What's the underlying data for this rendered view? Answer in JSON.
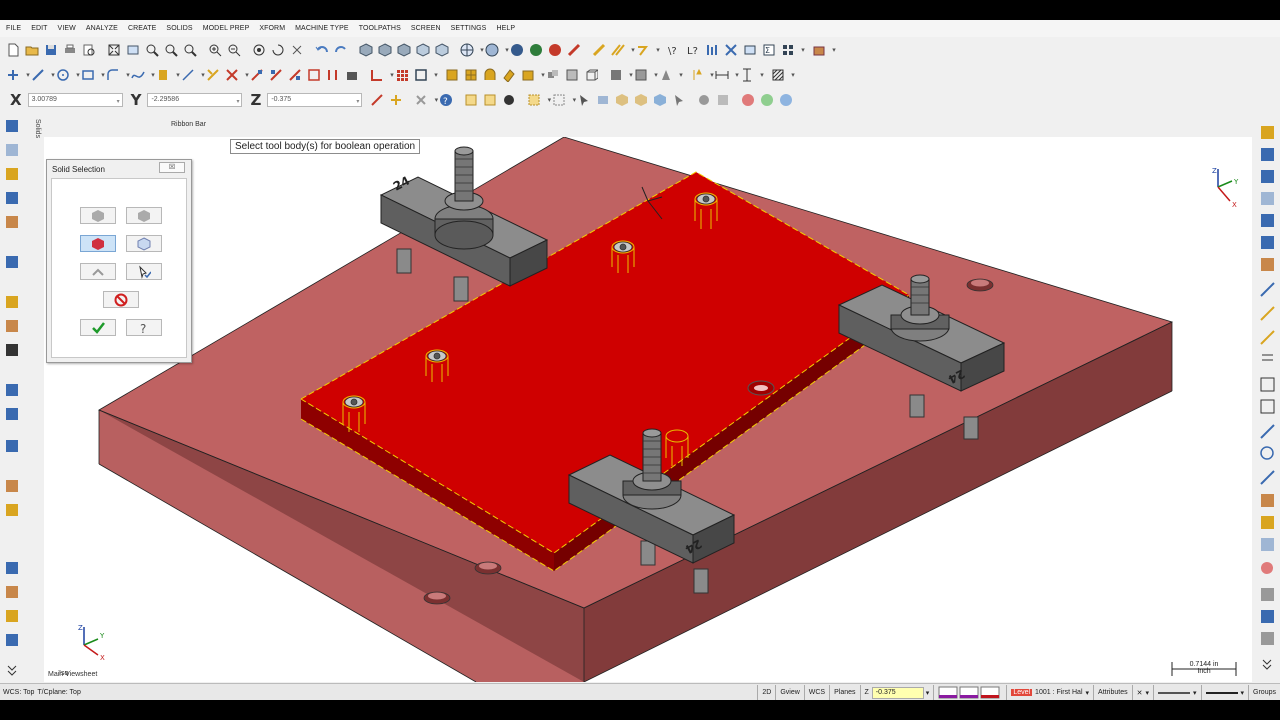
{
  "menu": [
    "FILE",
    "EDIT",
    "VIEW",
    "ANALYZE",
    "CREATE",
    "SOLIDS",
    "MODEL PREP",
    "XFORM",
    "MACHINE TYPE",
    "TOOLPATHS",
    "SCREEN",
    "SETTINGS",
    "HELP"
  ],
  "coords": {
    "x_label": "X",
    "x_value": "3.00789",
    "y_label": "Y",
    "y_value": "-2.29586",
    "z_label": "Z",
    "z_value": "-0.375"
  },
  "ribbon_label": "Ribbon Bar",
  "solids_tab": "Solids",
  "solid_panel": {
    "title": "Solid Selection",
    "close_glyph": "☒"
  },
  "viewport": {
    "prompt": "Select tool body(s) for boolean operation",
    "view_label": "Iso",
    "scale_value": "0.7144 in",
    "scale_unit": "Inch",
    "sheet_tab": "Main Viewsheet",
    "colors": {
      "fixture_plate": "#bf6262",
      "target_body": "#cf0000",
      "clamp": "#676767"
    }
  },
  "status": {
    "wcs": "WCS: Top",
    "tcplane": "T/Cplane: Top",
    "mode_2d": "2D",
    "gview": "Gview",
    "wcs_btn": "WCS",
    "planes": "Planes",
    "z_label": "Z",
    "z_value": "-0.375",
    "level_label": "Level",
    "level_value": "1001 : First Hal",
    "attributes": "Attributes",
    "groups": "Groups"
  }
}
